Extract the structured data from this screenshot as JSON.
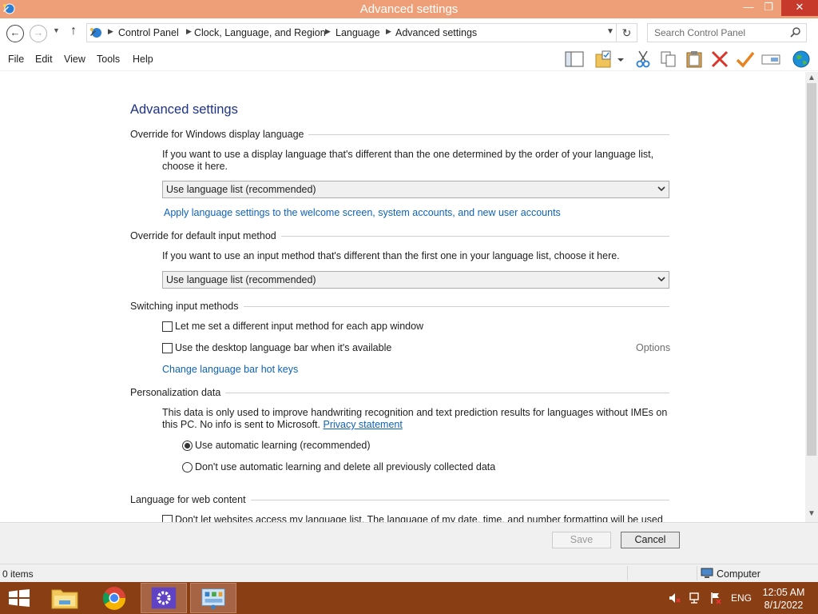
{
  "window": {
    "title": "Advanced settings",
    "min_glyph": "—",
    "max_glyph": "❐",
    "close_glyph": "✕"
  },
  "nav": {
    "back_glyph": "←",
    "forward_glyph": "→",
    "recent_glyph": "▼",
    "up_glyph": "↑",
    "breadcrumbs": [
      "Control Panel",
      "Clock, Language, and Region",
      "Language",
      "Advanced settings"
    ],
    "crumb_sep": "▶",
    "addr_dd_glyph": "▼",
    "refresh_glyph": "↻",
    "search_placeholder": "Search Control Panel"
  },
  "menu": {
    "items": [
      "File",
      "Edit",
      "View",
      "Tools",
      "Help"
    ],
    "toolbar_icons": [
      "layout-pane-icon",
      "folder-properties-icon",
      "cut-icon",
      "copy-icon",
      "paste-icon",
      "delete-icon",
      "checkmark-icon",
      "rename-icon",
      "globe-icon"
    ]
  },
  "content": {
    "page_title": "Advanced settings",
    "display_lang": {
      "heading": "Override for Windows display language",
      "description": "If you want to use a display language that's different than the one determined by the order of your language list, choose it here.",
      "selected": "Use language list (recommended)",
      "link": "Apply language settings to the welcome screen, system accounts, and new user accounts"
    },
    "input_method": {
      "heading": "Override for default input method",
      "description": "If you want to use an input method that's different than the first one in your language list, choose it here.",
      "selected": "Use language list (recommended)"
    },
    "switching": {
      "heading": "Switching input methods",
      "checkbox_per_app": "Let me set a different input method for each app window",
      "checkbox_per_app_checked": false,
      "checkbox_langbar": "Use the desktop language bar when it's available",
      "checkbox_langbar_checked": false,
      "options_label": "Options",
      "hotkeys_link": "Change language bar hot keys"
    },
    "personalization": {
      "heading": "Personalization data",
      "description": "This data is only used to improve handwriting recognition and text prediction results for languages without IMEs on this PC. No info is sent to Microsoft.",
      "privacy_link": "Privacy statement",
      "radio_auto": "Use automatic learning (recommended)",
      "radio_auto_selected": true,
      "radio_none": "Don't use automatic learning and delete all previously collected data",
      "radio_none_selected": false
    },
    "web_content": {
      "heading": "Language for web content",
      "checkbox_label": "Don't let websites access my language list. The language of my date, time, and number formatting will be used",
      "checked": false
    }
  },
  "scroll": {
    "up_glyph": "▲",
    "down_glyph": "▼"
  },
  "footer": {
    "save_label": "Save",
    "cancel_label": "Cancel"
  },
  "status": {
    "items_count": "0 items",
    "location": "Computer"
  },
  "taskbar": {
    "apps": [
      "file-explorer-icon",
      "chrome-icon",
      "settings-icon",
      "control-panel-icon"
    ],
    "active_app": "control-panel-icon",
    "language": "ENG",
    "time": "12:05 AM",
    "date": "8/1/2022",
    "accent_color": "#8a3e14"
  },
  "colors": {
    "titlebar": "#ee9f77",
    "close_button": "#c7392b",
    "heading_blue": "#1e3287",
    "link_blue": "#0f63b7"
  }
}
